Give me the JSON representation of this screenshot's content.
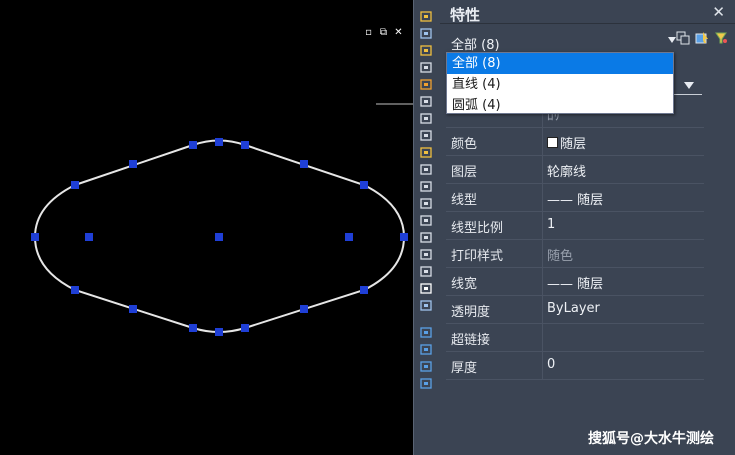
{
  "canvas": {
    "window_buttons": [
      "▫",
      "⧉",
      "✕"
    ]
  },
  "panel": {
    "title": "特性",
    "close": "✕",
    "selection_value": "全部 (8)",
    "dropdown_options": [
      {
        "label": "全部 (8)",
        "selected": true
      },
      {
        "label": "直线 (4)",
        "selected": false
      },
      {
        "label": "圆弧 (4)",
        "selected": false
      }
    ],
    "rows": [
      {
        "label": "",
        "value": "ﾛﾘ",
        "dim": true
      },
      {
        "label": "颜色",
        "value": "随层",
        "swatch": "#ffffff"
      },
      {
        "label": "图层",
        "value": "轮廓线"
      },
      {
        "label": "线型",
        "value": "—— 随层"
      },
      {
        "label": "线型比例",
        "value": "1"
      },
      {
        "label": "打印样式",
        "value": "随色",
        "dim": true
      },
      {
        "label": "线宽",
        "value": "—— 随层"
      },
      {
        "label": "透明度",
        "value": "ByLayer"
      },
      {
        "label": "超链接",
        "value": ""
      },
      {
        "label": "厚度",
        "value": "0"
      }
    ]
  },
  "watermark": "搜狐号@大水牛测绘",
  "colors": {
    "grip": "#1f3fd6",
    "panel_bg": "#3b4453",
    "highlight": "#0a7ae6"
  }
}
